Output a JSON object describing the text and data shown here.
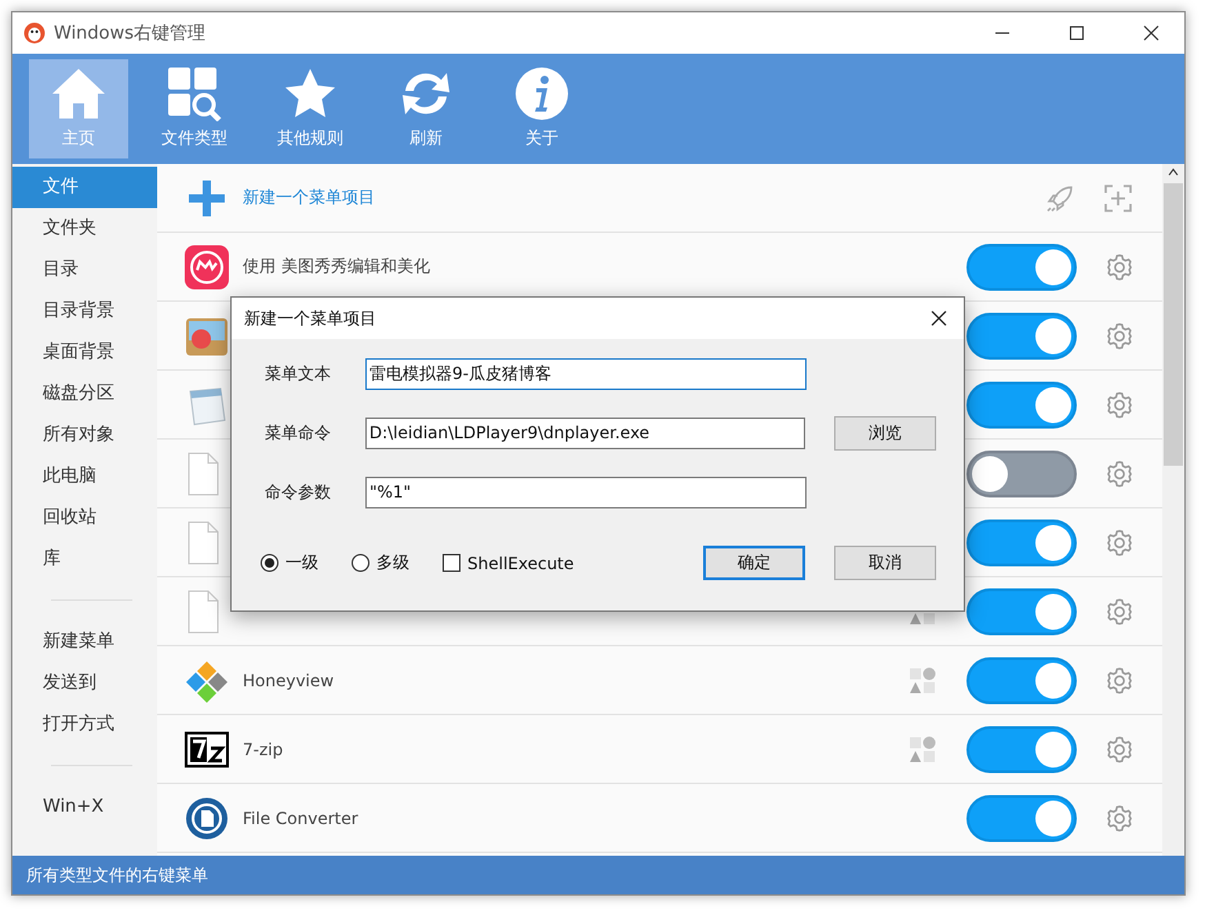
{
  "window": {
    "title": "Windows右键管理"
  },
  "toolbar": [
    {
      "label": "主页",
      "selected": true
    },
    {
      "label": "文件类型",
      "selected": false
    },
    {
      "label": "其他规则",
      "selected": false
    },
    {
      "label": "刷新",
      "selected": false
    },
    {
      "label": "关于",
      "selected": false
    }
  ],
  "sidebar": {
    "groups": [
      [
        {
          "label": "文件",
          "selected": true
        },
        {
          "label": "文件夹",
          "selected": false
        },
        {
          "label": "目录",
          "selected": false
        },
        {
          "label": "目录背景",
          "selected": false
        },
        {
          "label": "桌面背景",
          "selected": false
        },
        {
          "label": "磁盘分区",
          "selected": false
        },
        {
          "label": "所有对象",
          "selected": false
        },
        {
          "label": "此电脑",
          "selected": false
        },
        {
          "label": "回收站",
          "selected": false
        },
        {
          "label": "库",
          "selected": false
        }
      ],
      [
        {
          "label": "新建菜单",
          "selected": false
        },
        {
          "label": "发送到",
          "selected": false
        },
        {
          "label": "打开方式",
          "selected": false
        }
      ],
      [
        {
          "label": "Win+X",
          "selected": false
        }
      ]
    ]
  },
  "items": [
    {
      "kind": "new",
      "label": "新建一个菜单项目"
    },
    {
      "kind": "item",
      "label": "使用 美图秀秀编辑和美化",
      "on": true,
      "shapes": false
    },
    {
      "kind": "item",
      "on": true,
      "shapes": false
    },
    {
      "kind": "item",
      "on": true,
      "shapes": false
    },
    {
      "kind": "item",
      "on": false,
      "shapes": false
    },
    {
      "kind": "item",
      "on": true,
      "shapes": false
    },
    {
      "kind": "item",
      "on": true,
      "shapes": true
    },
    {
      "kind": "item",
      "label": "Honeyview",
      "on": true,
      "shapes": true
    },
    {
      "kind": "item",
      "label": "7-zip",
      "on": true,
      "shapes": true
    },
    {
      "kind": "item",
      "label": "File Converter",
      "on": true,
      "shapes": false
    }
  ],
  "status_bar": "所有类型文件的右键菜单",
  "dialog": {
    "title": "新建一个菜单项目",
    "fields": [
      {
        "label": "菜单文本",
        "value": "雷电模拟器9-瓜皮猪博客",
        "focused": true
      },
      {
        "label": "菜单命令",
        "value": "D:\\leidian\\LDPlayer9\\dnplayer.exe",
        "focused": false,
        "button": "浏览"
      },
      {
        "label": "命令参数",
        "value": "\"%1\"",
        "focused": false
      }
    ],
    "levels": [
      {
        "label": "一级",
        "selected": true
      },
      {
        "label": "多级",
        "selected": false
      }
    ],
    "shell_execute": {
      "label": "ShellExecute",
      "checked": false
    },
    "buttons": [
      {
        "label": "确定",
        "default": true
      },
      {
        "label": "取消",
        "default": false
      }
    ]
  }
}
